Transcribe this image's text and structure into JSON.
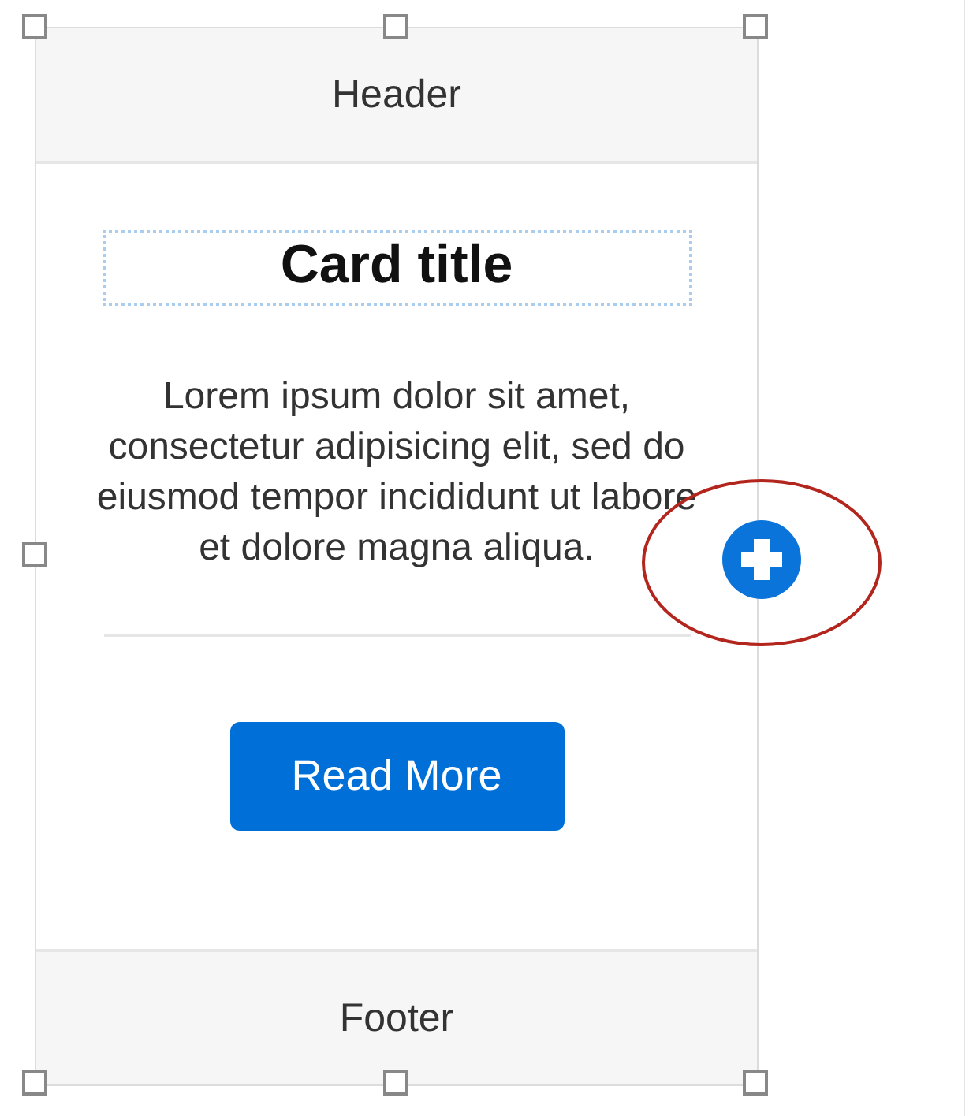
{
  "card": {
    "selected": true,
    "header": "Header",
    "title": "Card title",
    "body": "Lorem ipsum dolor sit amet, consectetur adipisicing elit, sed do eiusmod tempor incididunt ut labore et dolore magna aliqua.",
    "button": "Read More",
    "footer": "Footer"
  }
}
